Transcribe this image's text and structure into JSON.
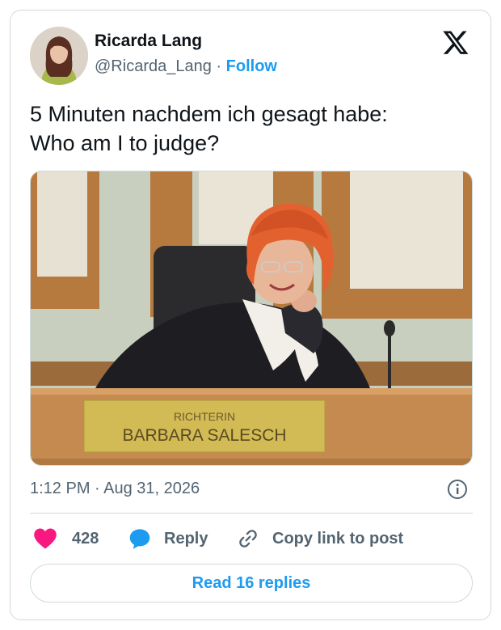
{
  "author": {
    "name": "Ricarda Lang",
    "handle": "@Ricarda_Lang",
    "separator": "·",
    "follow_label": "Follow"
  },
  "tweet": {
    "text_line1": "5 Minuten nachdem ich gesagt habe:",
    "text_line2": "Who am I to judge?"
  },
  "media": {
    "nameplate_line1": "RICHTERIN",
    "nameplate_line2": "BARBARA SALESCH"
  },
  "meta": {
    "timestamp": "1:12 PM · Aug 31, 2026"
  },
  "actions": {
    "likes_count": "428",
    "reply_label": "Reply",
    "copy_link_label": "Copy link to post"
  },
  "footer": {
    "read_replies_label": "Read 16 replies"
  },
  "colors": {
    "accent": "#1d9bf0",
    "like": "#f91880",
    "muted": "#536471"
  },
  "icons": [
    "x-logo-icon",
    "heart-icon",
    "reply-bubble-icon",
    "link-icon",
    "info-icon"
  ]
}
